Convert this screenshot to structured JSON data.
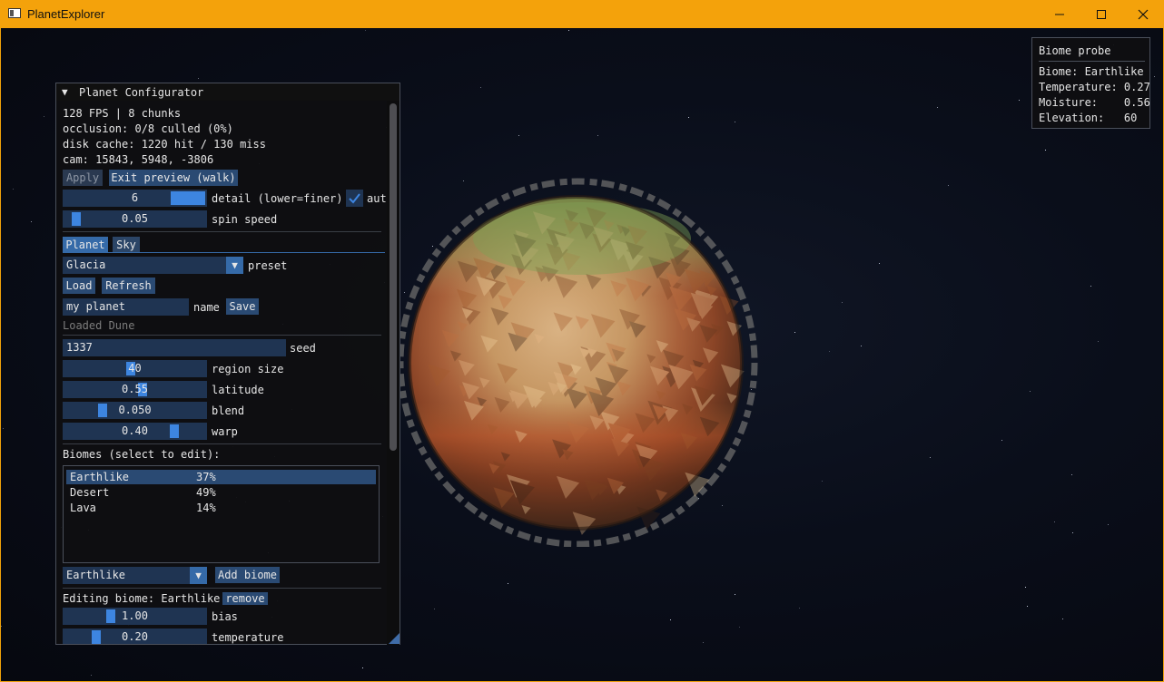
{
  "window": {
    "title": "PlanetExplorer",
    "minimize_icon": "minimize-icon",
    "maximize_icon": "maximize-icon",
    "close_icon": "close-icon"
  },
  "configurator": {
    "title": "Planet Configurator",
    "stats": [
      "128 FPS | 8 chunks",
      "occlusion: 0/8 culled (0%)",
      "disk cache: 1220 hit / 130 miss",
      "cam: 15843, 5948, -3806"
    ],
    "apply_label": "Apply",
    "exit_preview_label": "Exit preview (walk)",
    "detail": {
      "value": "6",
      "label": "detail (lower=finer)",
      "auto_label": "aut",
      "auto_checked": true
    },
    "spin": {
      "value": "0.05",
      "label": "spin speed"
    },
    "tabs": [
      {
        "label": "Planet",
        "active": true
      },
      {
        "label": "Sky",
        "active": false
      }
    ],
    "preset": {
      "value": "Glacia",
      "label": "preset"
    },
    "load_label": "Load",
    "refresh_label": "Refresh",
    "name": {
      "value": "my planet",
      "label": "name"
    },
    "save_label": "Save",
    "loaded_status": "Loaded Dune",
    "seed": {
      "value": "1337",
      "label": "seed"
    },
    "region_size": {
      "value": "40",
      "label": "region size"
    },
    "latitude": {
      "value": "0.55",
      "label": "latitude"
    },
    "blend": {
      "value": "0.050",
      "label": "blend"
    },
    "warp": {
      "value": "0.40",
      "label": "warp"
    },
    "biomes_header": "Biomes (select to edit):",
    "biomes": [
      {
        "name": "Earthlike",
        "percent": "37%",
        "selected": true
      },
      {
        "name": "Desert",
        "percent": "49%",
        "selected": false
      },
      {
        "name": "Lava",
        "percent": "14%",
        "selected": false
      }
    ],
    "biome_combo": {
      "value": "Earthlike"
    },
    "add_biome_label": "Add biome",
    "editing_label": "Editing biome: Earthlike",
    "remove_label": "remove",
    "bias": {
      "value": "1.00",
      "label": "bias"
    },
    "temperature": {
      "value": "0.20",
      "label": "temperature"
    }
  },
  "probe": {
    "title": "Biome probe",
    "rows": [
      "Biome: Earthlike",
      "Temperature: 0.27",
      "Moisture:    0.56",
      "Elevation:   60"
    ]
  },
  "colors": {
    "title_bar": "#f4a20b",
    "accent": "#3d85e0",
    "frame_bg": "#1f3452",
    "button": "#2a4a73"
  }
}
